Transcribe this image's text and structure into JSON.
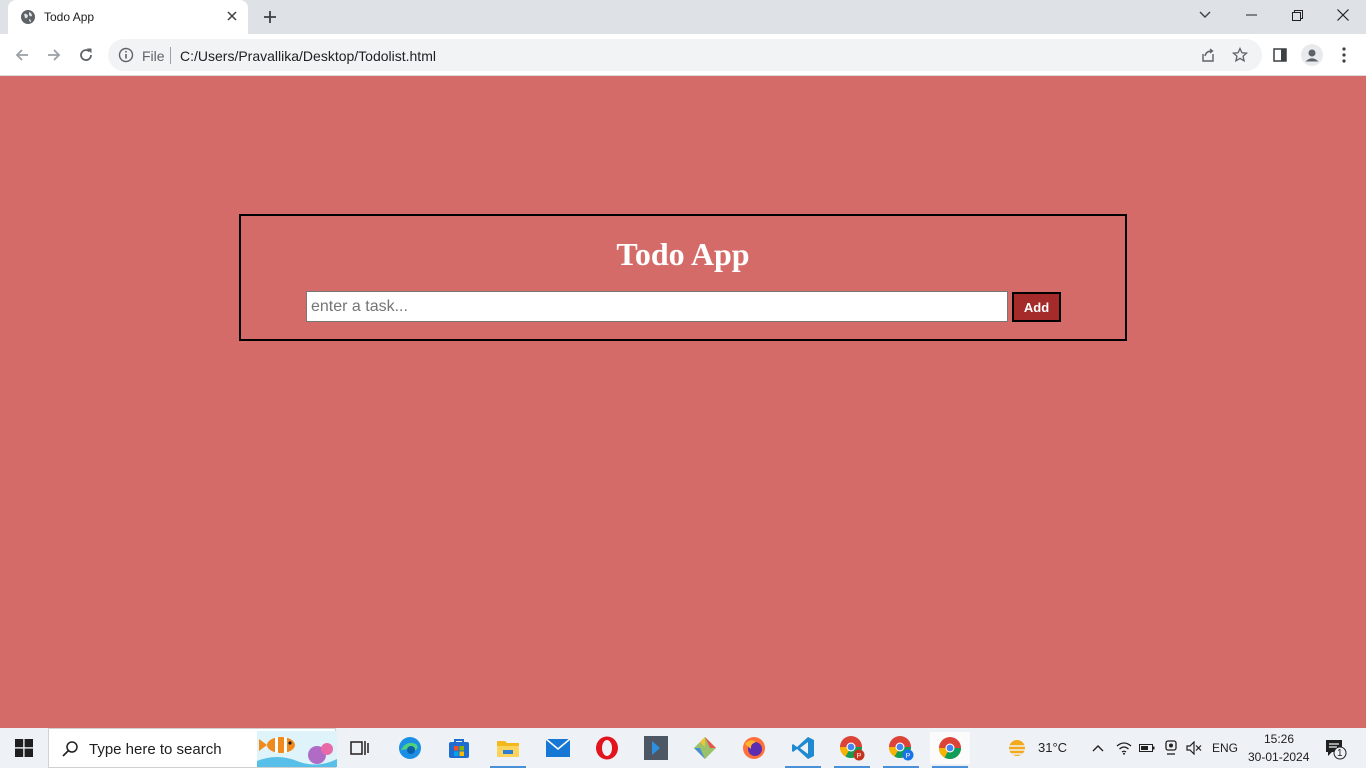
{
  "browser": {
    "tab_title": "Todo App",
    "scheme_label": "File",
    "url": "C:/Users/Pravallika/Desktop/Todolist.html"
  },
  "app": {
    "title": "Todo App",
    "input_placeholder": "enter a task...",
    "input_value": "",
    "add_label": "Add",
    "colors": {
      "background": "#d46b69",
      "add_button": "#a52a2a",
      "border": "#000000",
      "title": "#ffffff"
    }
  },
  "taskbar": {
    "search_placeholder": "Type here to search",
    "apps": [
      "task-view-icon",
      "edge-icon",
      "store-icon",
      "file-explorer-icon",
      "mail-icon",
      "opera-icon",
      "app-icon",
      "git-icon",
      "firefox-icon",
      "vscode-icon",
      "chrome-profile-p-icon",
      "chrome-profile-p2-icon",
      "chrome-icon"
    ],
    "weather": "31°C",
    "language": "ENG",
    "time": "15:26",
    "date": "30-01-2024",
    "notifications": "1"
  }
}
